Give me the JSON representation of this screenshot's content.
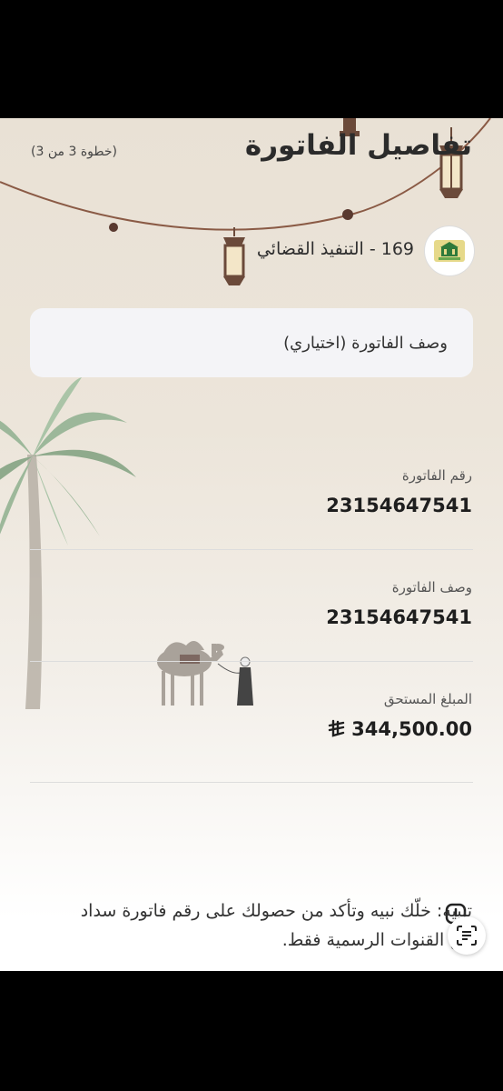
{
  "header": {
    "title": "تفاصيل الفاتورة",
    "step": "(خطوة 3 من 3)"
  },
  "biller": {
    "name": "169 - التنفيذ القضائي",
    "logo_icon": "biller-logo-icon"
  },
  "description_input": {
    "placeholder": "وصف الفاتورة (اختياري)",
    "value": ""
  },
  "fields": [
    {
      "label": "رقم الفاتورة",
      "value": "23154647541"
    },
    {
      "label": "وصف الفاتورة",
      "value": "23154647541"
    },
    {
      "label": "المبلغ المستحق",
      "value": "344,500.00",
      "currency_icon": "riyal-symbol-icon"
    }
  ],
  "notice": {
    "text": "تنبيه: خلّك نبيه وتأكد من حصولك على رقم فاتورة سداد من القنوات الرسمية فقط.",
    "icon": "alert-icon"
  },
  "scan_button": {
    "icon": "text-scan-icon"
  },
  "decorations": [
    "lantern-icon",
    "string-lights",
    "palm-tree-icon",
    "camel-icon",
    "man-figure-icon"
  ],
  "colors": {
    "background_top": "#e9e1d5",
    "card": "#f4f4f7",
    "text": "#1e1e1e",
    "accent_brown": "#6b4a3a"
  }
}
